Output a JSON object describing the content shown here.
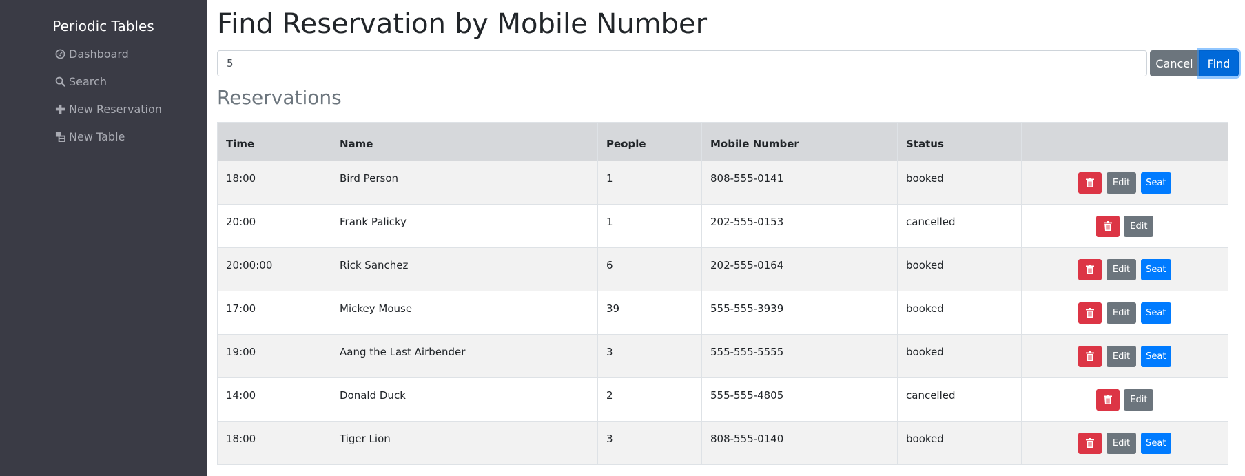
{
  "sidebar": {
    "brand": "Periodic Tables",
    "items": [
      {
        "label": "Dashboard",
        "icon": "dashboard-icon"
      },
      {
        "label": "Search",
        "icon": "search-icon"
      },
      {
        "label": "New Reservation",
        "icon": "plus-icon"
      },
      {
        "label": "New Table",
        "icon": "table-icon"
      }
    ]
  },
  "page": {
    "title": "Find Reservation by Mobile Number",
    "search_value": "5",
    "cancel_label": "Cancel",
    "find_label": "Find",
    "section_title": "Reservations"
  },
  "table": {
    "headers": [
      "Time",
      "Name",
      "People",
      "Mobile Number",
      "Status",
      ""
    ],
    "rows": [
      {
        "time": "18:00",
        "name": "Bird Person",
        "people": "1",
        "mobile": "808-555-0141",
        "status": "booked"
      },
      {
        "time": "20:00",
        "name": "Frank Palicky",
        "people": "1",
        "mobile": "202-555-0153",
        "status": "cancelled"
      },
      {
        "time": "20:00:00",
        "name": "Rick Sanchez",
        "people": "6",
        "mobile": "202-555-0164",
        "status": "booked"
      },
      {
        "time": "17:00",
        "name": "Mickey Mouse",
        "people": "39",
        "mobile": "555-555-3939",
        "status": "booked"
      },
      {
        "time": "19:00",
        "name": "Aang the Last Airbender",
        "people": "3",
        "mobile": "555-555-5555",
        "status": "booked"
      },
      {
        "time": "14:00",
        "name": "Donald Duck",
        "people": "2",
        "mobile": "555-555-4805",
        "status": "cancelled"
      },
      {
        "time": "18:00",
        "name": "Tiger Lion",
        "people": "3",
        "mobile": "808-555-0140",
        "status": "booked"
      }
    ],
    "edit_label": "Edit",
    "seat_label": "Seat"
  },
  "colors": {
    "sidebar_bg": "#3a3b45",
    "primary": "#007bff",
    "secondary": "#6c757d",
    "danger": "#dc3545"
  }
}
